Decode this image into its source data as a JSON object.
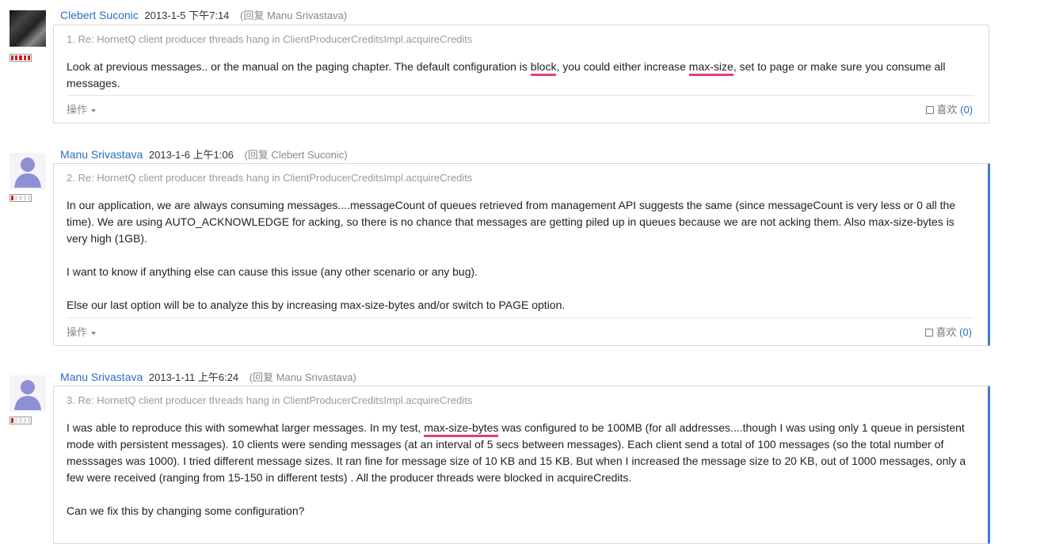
{
  "posts": [
    {
      "author": "Clebert Suconic",
      "date": "2013-1-5 下午7:14",
      "reply_to": "(回复 Manu Srivastava)",
      "subject": "1. Re: HornetQ client producer threads hang in ClientProducerCreditsImpl.acquireCredits",
      "body_parts": {
        "p1_a": "Look at previous messages.. or the manual on the paging chapter. The default configuration is ",
        "p1_hl1": "block",
        "p1_b": ", you could either increase ",
        "p1_hl2": "max-size",
        "p1_c": ", set to page or make sure you consume all messages."
      },
      "ops_label": "操作",
      "like_label": "喜欢",
      "like_count": "(0)",
      "rank_level": 5
    },
    {
      "author": "Manu Srivastava",
      "date": "2013-1-6 上午1:06",
      "reply_to": "(回复 Clebert Suconic)",
      "subject": "2. Re: HornetQ client producer threads hang in ClientProducerCreditsImpl.acquireCredits",
      "paragraphs": [
        "In  our application, we are always consuming messages....messageCount of queues retrieved from management API suggests the same (since messageCount is very less or 0 all the time). We are using AUTO_ACKNOWLEDGE for acking, so there is no chance that messages are getting piled up in queues because we are not acking them. Also max-size-bytes is very high (1GB).",
        "I want to know if anything else can cause this issue (any other scenario or any bug).",
        "Else our last option will be to analyze this by increasing max-size-bytes and/or switch to PAGE option."
      ],
      "ops_label": "操作",
      "like_label": "喜欢",
      "like_count": "(0)",
      "rank_level": 1
    },
    {
      "author": "Manu Srivastava",
      "date": "2013-1-11 上午6:24",
      "reply_to": "(回复 Manu Srivastava)",
      "subject": "3. Re: HornetQ client producer threads hang in ClientProducerCreditsImpl.acquireCredits",
      "body_parts": {
        "p1_a": "I was able to reproduce this with somewhat larger messages. In my test, ",
        "p1_hl1": "max-size-bytes",
        "p1_b": " was configured to be 100MB (for all addresses....though I was using only 1 queue in persistent mode with persistent messages). 10 clients were sending messages (at an interval of 5 secs between messages). Each client send a total of 100 messages (so the total number of messsages was 1000). I tried different message sizes. It ran fine for message size of 10 KB and 15 KB. But when I increased the message size to 20 KB, out of 1000 messages, only a few were received (ranging from 15-150 in different tests) . All the producer threads were blocked in acquireCredits.",
        "p2": "Can we fix this by changing some configuration?"
      },
      "rank_level": 1
    }
  ],
  "colors": {
    "author_link": "#2a6ebb",
    "highlight_underline": "#e0417a",
    "active_border": "#3a7bd5",
    "rank_on": "#d11b1b"
  }
}
